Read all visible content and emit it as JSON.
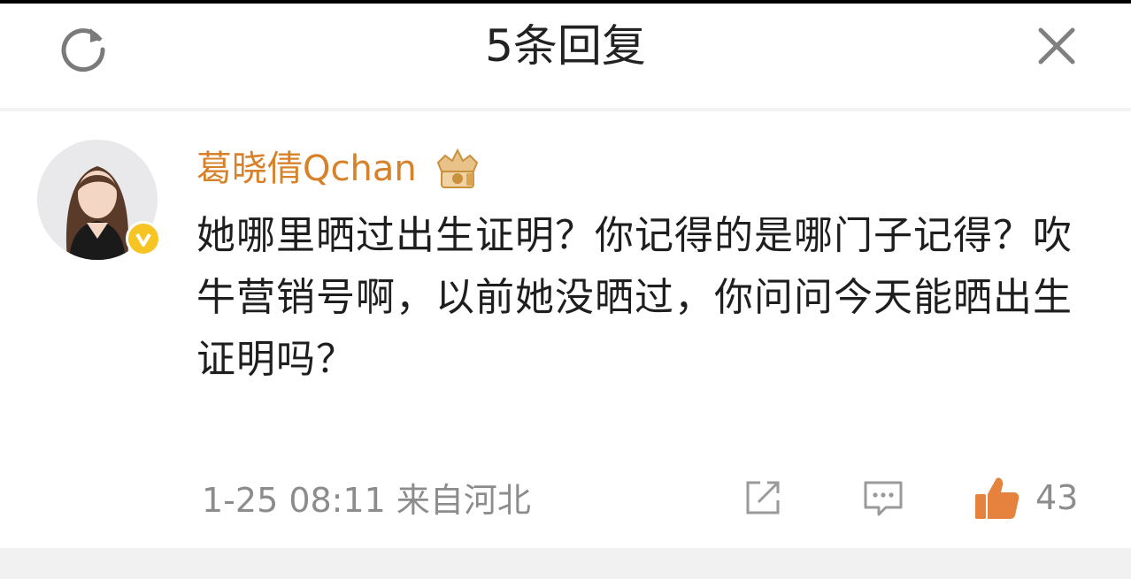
{
  "header": {
    "title": "5条回复",
    "refresh_icon": "refresh-icon",
    "close_icon": "close-icon"
  },
  "comment": {
    "username": "葛晓倩Qchan",
    "username_color": "#d7822a",
    "verified_icon": "vip-verified-badge-icon",
    "rank_icon": "crown-badge-icon",
    "text": "她哪里晒过出生证明？你记得的是哪门子记得？吹牛营销号啊，以前她没晒过，你问问今天能晒出生证明吗？",
    "meta": "1-25 08:11 来自河北",
    "like_count": "43",
    "like_color": "#e5823d"
  }
}
